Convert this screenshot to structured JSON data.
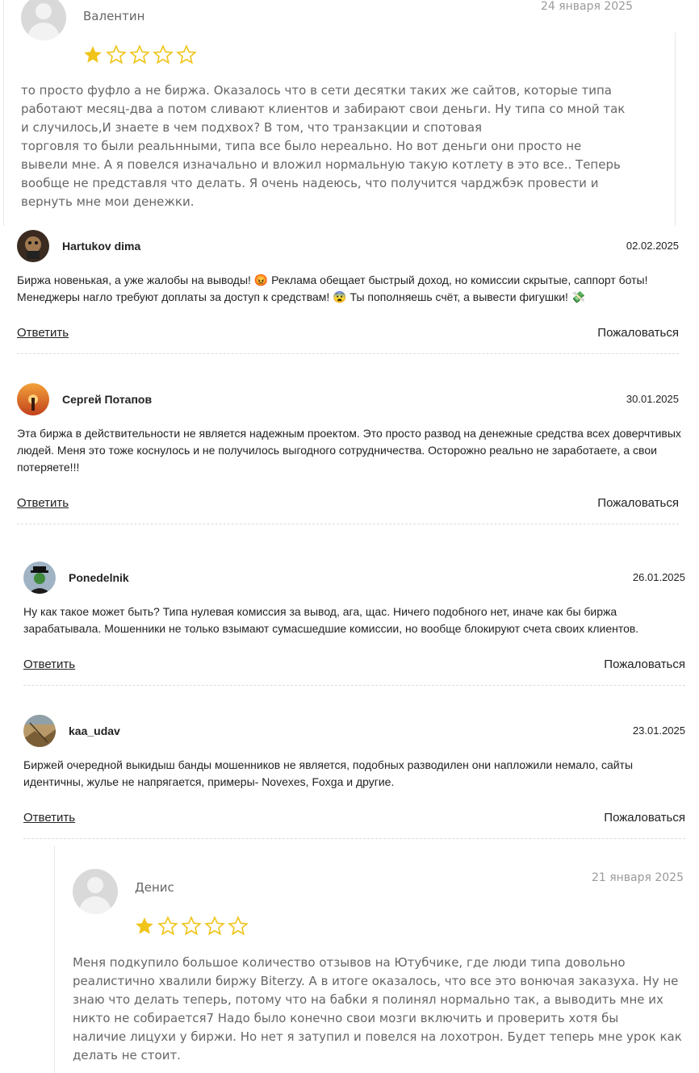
{
  "review_top": {
    "name": "Валентин",
    "date": "24 января 2025",
    "rating": 1,
    "lines": [
      "то просто фуфло а не биржа. Оказалось что в сети десятки таких же сайтов, которые типа",
      "работают месяц-два а потом сливают клиентов и забирают свои деньги. Ну типа со мной так",
      "и случилось,И знаете в чем подхвох? В том, что транзакции и спотовая",
      "торговля то были реальнными, типа все было нереально. Но вот деньги они просто не",
      "вывели мне. А я повелся изначально и вложил нормальную такую котлету в это все.. Теперь",
      "вообще не представля что делать. Я очень надеюсь, что получится чарджбэк провести и",
      "вернуть мне мои денежки."
    ]
  },
  "comments": [
    {
      "name": "Hartukov dima",
      "date": "02.02.2025",
      "lines": [
        "Биржа новенькая, а уже жалобы на выводы! 😡 Реклама обещает быстрый доход, но комиссии скрытые, саппорт боты!",
        "Менеджеры нагло требуют доплаты за доступ к средствам! 😨 Ты пополняешь счёт, а вывести фигушки! 💸"
      ],
      "reply": "Ответить",
      "report": "Пожаловаться"
    },
    {
      "name": "Сергей Потапов",
      "date": "30.01.2025",
      "lines": [
        "Эта биржа в действительности не является надежным проектом. Это просто развод на денежные средства всех доверчтивых",
        "людей. Меня это тоже коснулось и не получилось выгодного сотрудничества. Осторожно реально не заработаете, а свои",
        "потеряете!!!"
      ],
      "reply": "Ответить",
      "report": "Пожаловаться"
    },
    {
      "name": "Ponedelnik",
      "date": "26.01.2025",
      "lines": [
        "Ну как такое может быть? Типа нулевая комиссия за вывод, ага, щас. Ничего подобного нет, иначе как бы биржа",
        "зарабатывала. Мошенники не только взымают сумасшедшие комиссии, но вообще блокируют счета своих клиентов."
      ],
      "reply": "Ответить",
      "report": "Пожаловаться"
    },
    {
      "name": "kaa_udav",
      "date": "23.01.2025",
      "lines": [
        "Биржей очередной выкидыш банды мошенников не является, подобных разводилен они напложили немало, сайты",
        "идентичны, жулье не напрягается, примеры- Novexes, Foxga и другие."
      ],
      "reply": "Ответить",
      "report": "Пожаловаться"
    }
  ],
  "review_bottom": {
    "name": "Денис",
    "date": "21 января 2025",
    "rating": 1,
    "lines": [
      "Меня подкупило большое количество отзывов на Ютубчике, где люди типа довольно",
      "реалистично хвалили биржу Biterzy. А в итоге оказалось, что все это вонючая заказуха. Ну не",
      "знаю что делать теперь, потому что на бабки я полинял нормально так, а выводить мне их",
      "никто не собирается7 Надо было конечно свои мозги включить и проверить хотя бы",
      "наличие лицухи у биржи. Но нет я затупил и повелся на лохотрон. Будет теперь мне урок как",
      "делать не стоит."
    ]
  },
  "colors": {
    "star": "#f0c419",
    "star_empty": "#f0c419"
  }
}
